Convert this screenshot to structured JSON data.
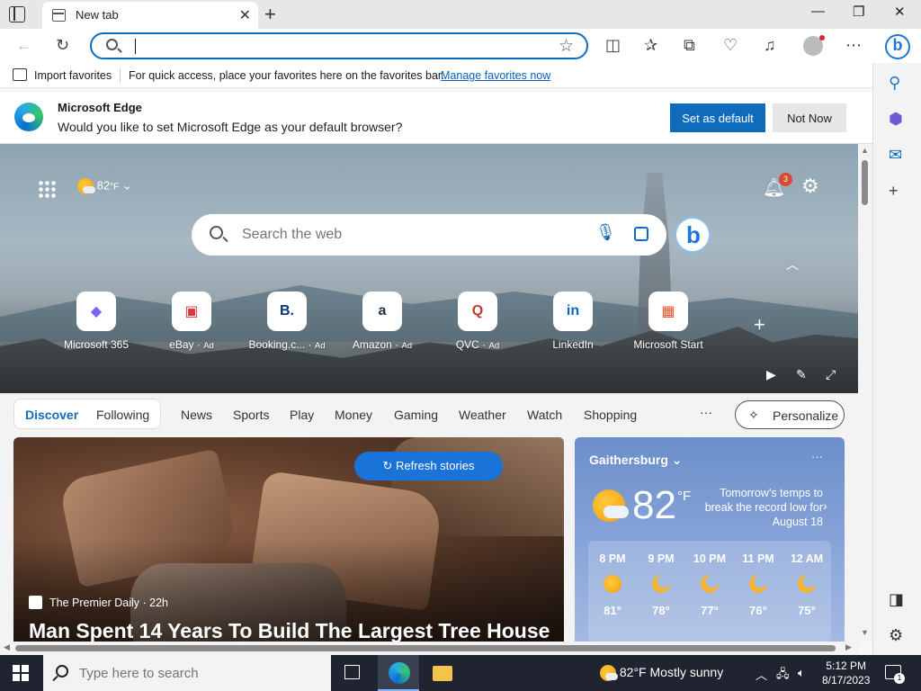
{
  "tab": {
    "title": "New tab",
    "close": "✕"
  },
  "window": {
    "new_tab": "+",
    "minimize": "—",
    "restore": "❐",
    "close": "✕"
  },
  "address": {
    "value": ""
  },
  "favbar": {
    "import_label": "Import favorites",
    "hint": "For quick access, place your favorites here on the favorites bar.",
    "manage_link": "Manage favorites now"
  },
  "infobar": {
    "title": "Microsoft Edge",
    "message": "Would you like to set Microsoft Edge as your default browser?",
    "set_default": "Set as default",
    "not_now": "Not Now"
  },
  "hero": {
    "weather_temp": "82",
    "weather_unit": "°F",
    "notification_count": "3",
    "search_placeholder": "Search the web"
  },
  "quick_links": [
    {
      "label": "Microsoft 365",
      "ad": "",
      "icon": "m365-icon",
      "color": "#7b61ff"
    },
    {
      "label": "eBay",
      "ad": "Ad",
      "icon": "ebay-bag-icon",
      "color": "#e53238"
    },
    {
      "label": "Booking.c...",
      "ad": "Ad",
      "icon": "booking-icon",
      "color": "#003580"
    },
    {
      "label": "Amazon",
      "ad": "Ad",
      "icon": "amazon-icon",
      "color": "#232f3e"
    },
    {
      "label": "QVC",
      "ad": "Ad",
      "icon": "qvc-icon",
      "color": "#c0392b"
    },
    {
      "label": "LinkedIn",
      "ad": "",
      "icon": "linkedin-icon",
      "color": "#0a66c2"
    },
    {
      "label": "Microsoft Start",
      "ad": "",
      "icon": "microsoft-logo-icon",
      "color": "#f25022"
    }
  ],
  "nav": {
    "discover": "Discover",
    "following": "Following",
    "categories": [
      "News",
      "Sports",
      "Play",
      "Money",
      "Gaming",
      "Weather",
      "Watch",
      "Shopping"
    ],
    "more": "···",
    "personalize": "Personalize"
  },
  "story": {
    "refresh": "Refresh stories",
    "source": "The Premier Daily · 22h",
    "headline": "Man Spent 14 Years To Build The Largest Tree House"
  },
  "weather_card": {
    "city": "Gaithersburg",
    "temp": "82",
    "unit": "°F",
    "note": "Tomorrow's temps to break the record low for August 18",
    "hourly": [
      {
        "time": "8 PM",
        "temp": "81°"
      },
      {
        "time": "9 PM",
        "temp": "78°"
      },
      {
        "time": "10 PM",
        "temp": "77°"
      },
      {
        "time": "11 PM",
        "temp": "76°"
      },
      {
        "time": "12 AM",
        "temp": "75°"
      }
    ]
  },
  "taskbar": {
    "search_placeholder": "Type here to search",
    "weather": "82°F  Mostly sunny",
    "time": "5:12 PM",
    "date": "8/17/2023",
    "notif_count": "1"
  },
  "colors": {
    "accent": "#0f6cbd",
    "taskbar": "#1f2430"
  }
}
